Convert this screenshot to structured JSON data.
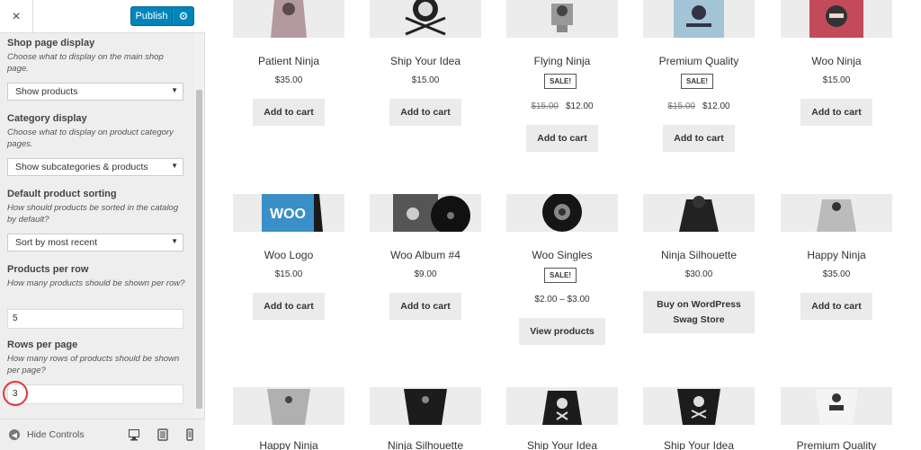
{
  "sidebar": {
    "close_icon": "×",
    "publish_label": "Publish",
    "gear_icon": "⚙",
    "sections": {
      "shop": {
        "title": "Shop page display",
        "desc": "Choose what to display on the main shop page.",
        "value": "Show products"
      },
      "category": {
        "title": "Category display",
        "desc": "Choose what to display on product category pages.",
        "value": "Show subcategories & products"
      },
      "sorting": {
        "title": "Default product sorting",
        "desc": "How should products be sorted in the catalog by default?",
        "value": "Sort by most recent"
      },
      "per_row": {
        "title": "Products per row",
        "desc": "How many products should be shown per row?",
        "value": "5"
      },
      "rows": {
        "title": "Rows per page",
        "desc": "How many rows of products should be shown per page?",
        "value": "3"
      }
    },
    "caret": "▼",
    "hide_controls": "Hide Controls",
    "hide_icon": "◀"
  },
  "products": [
    {
      "name": "Patient Ninja",
      "price": "$35.00",
      "button": "Add to cart"
    },
    {
      "name": "Ship Your Idea",
      "price": "$15.00",
      "button": "Add to cart"
    },
    {
      "name": "Flying Ninja",
      "sale": "SALE!",
      "old_price": "$15.00",
      "price": "$12.00",
      "button": "Add to cart"
    },
    {
      "name": "Premium Quality",
      "sale": "SALE!",
      "old_price": "$15.00",
      "price": "$12.00",
      "button": "Add to cart"
    },
    {
      "name": "Woo Ninja",
      "price": "$15.00",
      "button": "Add to cart"
    },
    {
      "name": "Woo Logo",
      "price": "$15.00",
      "button": "Add to cart"
    },
    {
      "name": "Woo Album #4",
      "price": "$9.00",
      "button": "Add to cart"
    },
    {
      "name": "Woo Singles",
      "sale": "SALE!",
      "price": "$2.00 – $3.00",
      "button": "View products"
    },
    {
      "name": "Ninja Silhouette",
      "price": "$30.00",
      "button": "Buy on WordPress Swag Store"
    },
    {
      "name": "Happy Ninja",
      "price": "$35.00",
      "button": "Add to cart"
    },
    {
      "name": "Happy Ninja"
    },
    {
      "name": "Ninja Silhouette"
    },
    {
      "name": "Ship Your Idea"
    },
    {
      "name": "Ship Your Idea"
    },
    {
      "name": "Premium Quality"
    }
  ],
  "woo_logo_text": "WOO"
}
